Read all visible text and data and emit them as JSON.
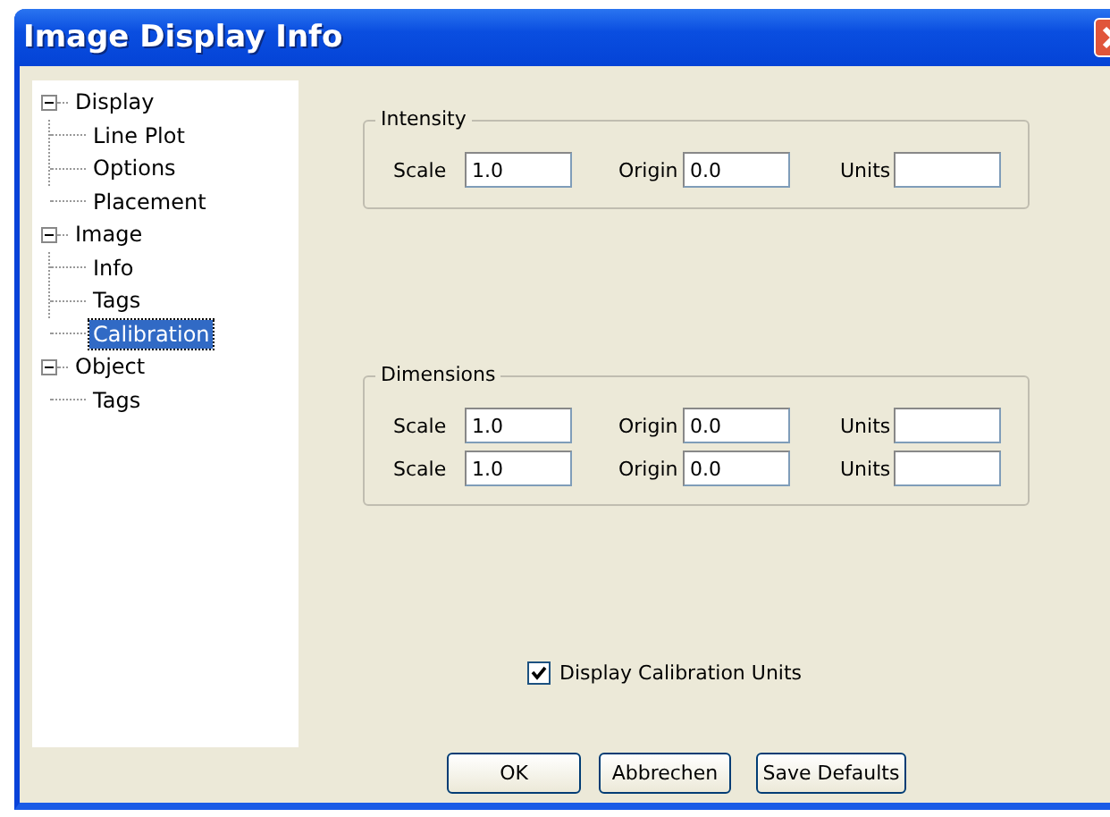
{
  "window": {
    "title": "Image Display Info"
  },
  "tree": [
    {
      "label": "Display",
      "expanded": true,
      "selected": false,
      "children": [
        {
          "label": "Line Plot",
          "selected": false
        },
        {
          "label": "Options",
          "selected": false
        },
        {
          "label": "Placement",
          "selected": false
        }
      ]
    },
    {
      "label": "Image",
      "expanded": true,
      "selected": false,
      "children": [
        {
          "label": "Info",
          "selected": false
        },
        {
          "label": "Tags",
          "selected": false
        },
        {
          "label": "Calibration",
          "selected": true
        }
      ]
    },
    {
      "label": "Object",
      "expanded": true,
      "selected": false,
      "children": [
        {
          "label": "Tags",
          "selected": false
        }
      ]
    }
  ],
  "groups": [
    {
      "title": "Intensity",
      "rows": [
        {
          "scale_label": "Scale",
          "scale": "1.0",
          "origin_label": "Origin",
          "origin": "0.0",
          "units_label": "Units"
        }
      ]
    },
    {
      "title": "Dimensions",
      "rows": [
        {
          "scale_label": "Scale",
          "scale": "1.0",
          "origin_label": "Origin",
          "origin": "0.0",
          "units_label": "Units"
        },
        {
          "scale_label": "Scale",
          "scale": "1.0",
          "origin_label": "Origin",
          "origin": "0.0",
          "units_label": "Units"
        }
      ]
    }
  ],
  "checkbox": {
    "label": "Display Calibration Units",
    "checked": true
  },
  "buttons": [
    "OK",
    "Abbrechen",
    "Save Defaults"
  ]
}
